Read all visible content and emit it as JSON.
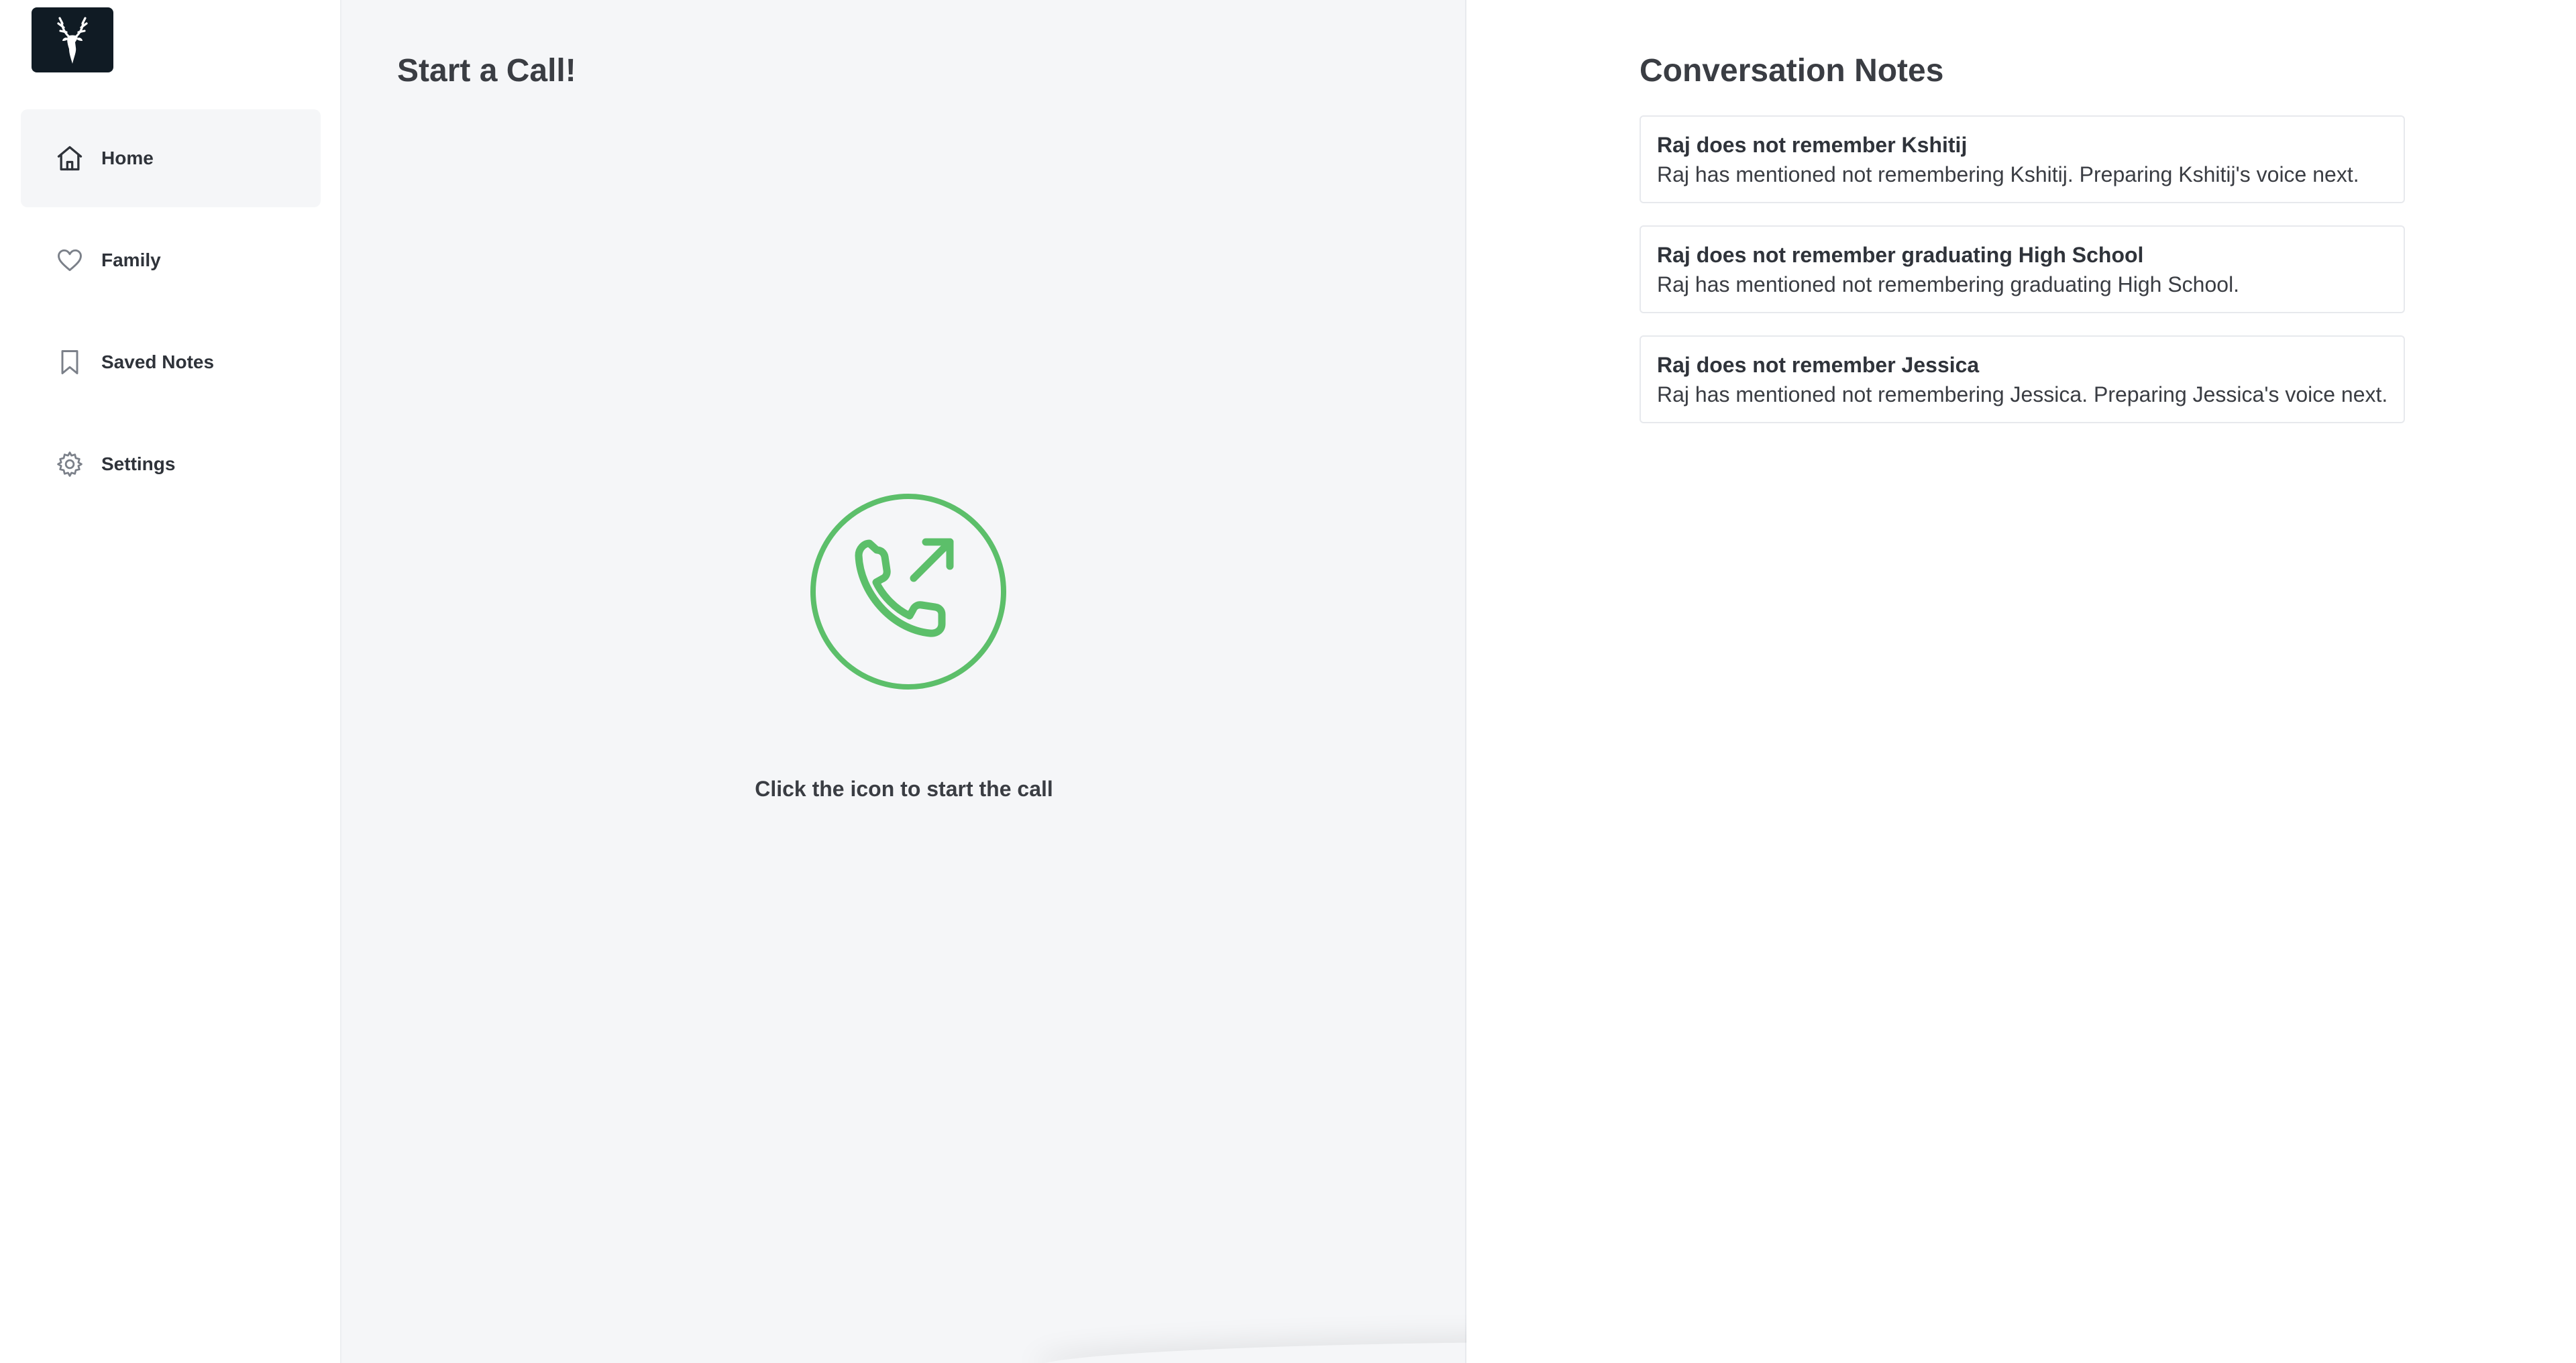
{
  "sidebar": {
    "logo_icon": "deer-icon",
    "items": [
      {
        "label": "Home",
        "icon": "home-icon",
        "active": true
      },
      {
        "label": "Family",
        "icon": "heart-icon",
        "active": false
      },
      {
        "label": "Saved Notes",
        "icon": "bookmark-icon",
        "active": false
      },
      {
        "label": "Settings",
        "icon": "gear-icon",
        "active": false
      }
    ]
  },
  "main": {
    "title": "Start a Call!",
    "call_icon": "phone-outgoing-icon",
    "hint": "Click the icon to start the call"
  },
  "notes": {
    "title": "Conversation Notes",
    "items": [
      {
        "title": "Raj does not remember Kshitij",
        "body": "Raj has mentioned not remembering Kshitij. Preparing Kshitij's voice next."
      },
      {
        "title": "Raj does not remember graduating High School",
        "body": "Raj has mentioned not remembering graduating High School."
      },
      {
        "title": "Raj does not remember Jessica",
        "body": "Raj has mentioned not remembering Jessica. Preparing Jessica's voice next."
      }
    ]
  },
  "colors": {
    "accent_green": "#5cbf6a",
    "logo_bg": "#101b24",
    "panel_bg": "#f5f6f8"
  }
}
